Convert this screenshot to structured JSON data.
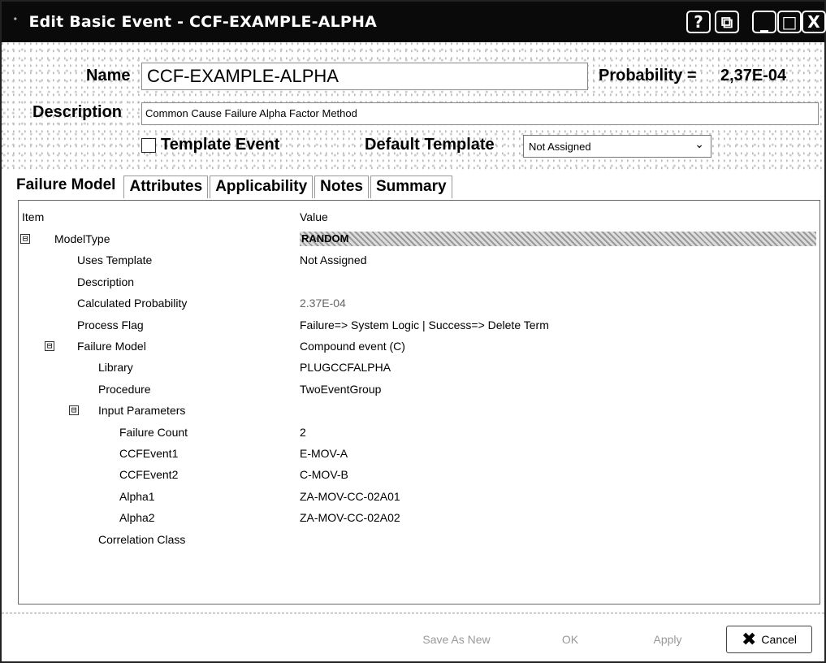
{
  "window": {
    "title": "Edit Basic Event - CCF-EXAMPLE-ALPHA",
    "controls": {
      "help": "?",
      "restore": "⧉",
      "minimize": "_",
      "maximize": "□",
      "close": "X"
    }
  },
  "header": {
    "name_label": "Name",
    "name_value": "CCF-EXAMPLE-ALPHA",
    "probability_label": "Probability =",
    "probability_value": "2,37E-04",
    "description_label": "Description",
    "description_value": "Common Cause Failure Alpha Factor Method",
    "template_event_label": "Template Event",
    "template_event_checked": false,
    "default_template_label": "Default Template",
    "default_template_value": "Not Assigned"
  },
  "tabs": [
    {
      "label": "Failure Model",
      "active": true
    },
    {
      "label": "Attributes",
      "active": false
    },
    {
      "label": "Applicability",
      "active": false
    },
    {
      "label": "Notes",
      "active": false
    },
    {
      "label": "Summary",
      "active": false
    }
  ],
  "grid": {
    "columns": [
      "Item",
      "Value"
    ],
    "rows": [
      {
        "item": "ModelType",
        "value": "RANDOM",
        "level": 0,
        "expander": "⊟"
      },
      {
        "item": "Uses Template",
        "value": "Not Assigned",
        "level": 1
      },
      {
        "item": "Description",
        "value": "",
        "level": 1
      },
      {
        "item": "Calculated Probability",
        "value": "2.37E-04",
        "level": 1
      },
      {
        "item": "Process Flag",
        "value": "Failure=> System Logic    | Success=> Delete Term",
        "level": 1
      },
      {
        "item": "Failure Model",
        "value": "Compound event (C)",
        "level": 1,
        "expander": "⊟"
      },
      {
        "item": "Library",
        "value": "PLUGCCFALPHA",
        "level": 2
      },
      {
        "item": "Procedure",
        "value": "TwoEventGroup",
        "level": 2
      },
      {
        "item": "Input Parameters",
        "value": "",
        "level": 2,
        "expander": "⊟"
      },
      {
        "item": "Failure Count",
        "value": "2",
        "level": 3
      },
      {
        "item": "CCFEvent1",
        "value": "E-MOV-A",
        "level": 3
      },
      {
        "item": "CCFEvent2",
        "value": "C-MOV-B",
        "level": 3
      },
      {
        "item": "Alpha1",
        "value": "ZA-MOV-CC-02A01",
        "level": 3
      },
      {
        "item": "Alpha2",
        "value": "ZA-MOV-CC-02A02",
        "level": 3
      },
      {
        "item": "Correlation Class",
        "value": "",
        "level": 2
      }
    ]
  },
  "footer": {
    "save_as_new": "Save As New",
    "ok": "OK",
    "apply": "Apply",
    "cancel": "Cancel"
  }
}
